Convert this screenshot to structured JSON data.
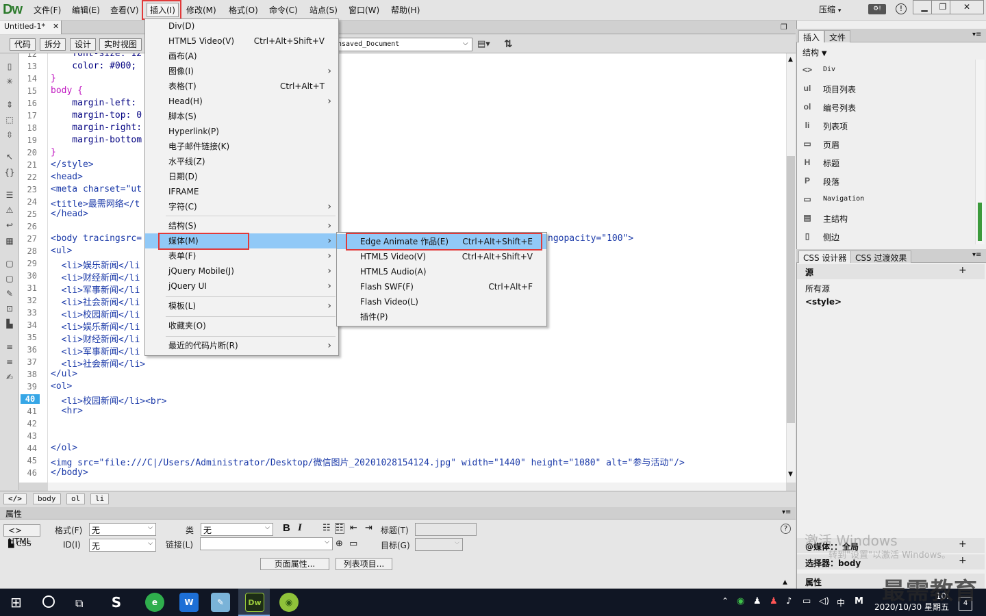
{
  "app": {
    "logo": "Dw",
    "compress_label": "压缩"
  },
  "menubar": {
    "items": [
      "文件(F)",
      "编辑(E)",
      "查看(V)",
      "插入(I)",
      "修改(M)",
      "格式(O)",
      "命令(C)",
      "站点(S)",
      "窗口(W)",
      "帮助(H)"
    ]
  },
  "document": {
    "tab": "Untitled-1*",
    "title_value": "nsaved_Document"
  },
  "view_buttons": [
    "代码",
    "拆分",
    "设计",
    "实时视图"
  ],
  "code": {
    "lines": [
      {
        "n": "12",
        "t": "    font-size: 12"
      },
      {
        "n": "13",
        "t": "    color: #000;"
      },
      {
        "n": "14",
        "t": "}"
      },
      {
        "n": "15",
        "t": "body {"
      },
      {
        "n": "16",
        "t": "    margin-left:"
      },
      {
        "n": "17",
        "t": "    margin-top: 0"
      },
      {
        "n": "18",
        "t": "    margin-right:"
      },
      {
        "n": "19",
        "t": "    margin-bottom"
      },
      {
        "n": "20",
        "t": "}"
      },
      {
        "n": "21",
        "t": "</style>"
      },
      {
        "n": "22",
        "t": "<head>"
      },
      {
        "n": "23",
        "t": "<meta charset=\"ut"
      },
      {
        "n": "24",
        "t": "<title>最需网络</t"
      },
      {
        "n": "25",
        "t": "</head>"
      },
      {
        "n": "26",
        "t": ""
      },
      {
        "n": "27",
        "t": "<body tracingsrc="
      },
      {
        "n": "28",
        "t": "<ul>"
      },
      {
        "n": "29",
        "t": "  <li>娱乐新闻</li"
      },
      {
        "n": "30",
        "t": "  <li>财经新闻</li"
      },
      {
        "n": "31",
        "t": "  <li>军事新闻</li"
      },
      {
        "n": "32",
        "t": "  <li>社会新闻</li"
      },
      {
        "n": "33",
        "t": "  <li>校园新闻</li"
      },
      {
        "n": "34",
        "t": "  <li>娱乐新闻</li"
      },
      {
        "n": "35",
        "t": "  <li>财经新闻</li"
      },
      {
        "n": "36",
        "t": "  <li>军事新闻</li"
      },
      {
        "n": "37",
        "t": "  <li>社会新闻</li>"
      },
      {
        "n": "38",
        "t": "</ul>"
      },
      {
        "n": "39",
        "t": "<ol>"
      },
      {
        "n": "40",
        "t": "  <li>校园新闻</li><br>"
      },
      {
        "n": "41",
        "t": "  <hr>"
      },
      {
        "n": "42",
        "t": ""
      },
      {
        "n": "43",
        "t": ""
      },
      {
        "n": "44",
        "t": "</ol>"
      },
      {
        "n": "45",
        "t": "<img src=\"file:///C|/Users/Administrator/Desktop/微信图片_20201028154124.jpg\" width=\"1440\" height=\"1080\" alt=\"参与活动\"/>"
      },
      {
        "n": "46",
        "t": "</body>"
      }
    ],
    "line27_tail": "ngopacity=\"100\">",
    "current_line": "40"
  },
  "breadcrumbs": [
    "body",
    "ol",
    "li"
  ],
  "insert_menu": [
    {
      "label": "Div(D)"
    },
    {
      "label": "HTML5 Video(V)",
      "shortcut": "Ctrl+Alt+Shift+V"
    },
    {
      "label": "画布(A)"
    },
    {
      "label": "图像(I)",
      "sub": true
    },
    {
      "label": "表格(T)",
      "shortcut": "Ctrl+Alt+T"
    },
    {
      "label": "Head(H)",
      "sub": true
    },
    {
      "label": "脚本(S)"
    },
    {
      "label": "Hyperlink(P)"
    },
    {
      "label": "电子邮件链接(K)"
    },
    {
      "label": "水平线(Z)"
    },
    {
      "label": "日期(D)"
    },
    {
      "label": "IFRAME"
    },
    {
      "label": "字符(C)",
      "sub": true
    },
    {
      "label": "结构(S)",
      "sub": true
    },
    {
      "label": "媒体(M)",
      "sub": true
    },
    {
      "label": "表单(F)",
      "sub": true
    },
    {
      "label": "jQuery Mobile(J)",
      "sub": true
    },
    {
      "label": "jQuery UI",
      "sub": true
    },
    {
      "label": "模板(L)",
      "sub": true
    },
    {
      "label": "收藏夹(O)"
    },
    {
      "label": "最近的代码片断(R)",
      "sub": true
    }
  ],
  "media_menu": [
    {
      "label": "Edge Animate 作品(E)",
      "shortcut": "Ctrl+Alt+Shift+E"
    },
    {
      "label": "HTML5 Video(V)",
      "shortcut": "Ctrl+Alt+Shift+V"
    },
    {
      "label": "HTML5 Audio(A)"
    },
    {
      "label": "Flash SWF(F)",
      "shortcut": "Ctrl+Alt+F"
    },
    {
      "label": "Flash Video(L)"
    },
    {
      "label": "插件(P)"
    }
  ],
  "right_panel": {
    "tabs": [
      "插入",
      "文件"
    ],
    "category": "结构",
    "items": [
      {
        "icon": "<>",
        "label": "Div"
      },
      {
        "icon": "ul",
        "label": "项目列表"
      },
      {
        "icon": "ol",
        "label": "编号列表"
      },
      {
        "icon": "li",
        "label": "列表项"
      },
      {
        "icon": "▭",
        "label": "页眉"
      },
      {
        "icon": "H",
        "label": "标题"
      },
      {
        "icon": "P",
        "label": "段落"
      },
      {
        "icon": "▭",
        "label": "Navigation"
      },
      {
        "icon": "▤",
        "label": "主结构"
      },
      {
        "icon": "▯",
        "label": "侧边"
      }
    ],
    "css_tabs": [
      "CSS 设计器",
      "CSS 过渡效果"
    ],
    "source_label": "源",
    "sources": [
      "所有源",
      "<style>"
    ],
    "media_label": "@媒体：：全局",
    "selector_label": "选择器：body",
    "props_label": "属性"
  },
  "properties": {
    "title": "属性",
    "html_btn": "HTML",
    "css_btn": "CSS",
    "format_label": "格式(F)",
    "format_value": "无",
    "class_label": "类",
    "class_value": "无",
    "id_label": "ID(I)",
    "id_value": "无",
    "link_label": "链接(L)",
    "title_label": "标题(T)",
    "target_label": "目标(G)",
    "page_props_btn": "页面属性...",
    "list_item_btn": "列表项目..."
  },
  "watermark": {
    "activate_title": "激活 Windows",
    "activate_sub": "转到\"设置\"以激活 Windows。",
    "logo_text": "最需教育"
  },
  "taskbar": {
    "time": "10:",
    "date": "2020/10/30 星期五",
    "ime": "中",
    "ime2": "M",
    "notif": "4"
  },
  "colors": {
    "accent": "#36a6e6",
    "highlight": "#91c9f7",
    "red_box": "#e13a3a",
    "tag": "#1a39a8",
    "selector": "#c016c0"
  }
}
